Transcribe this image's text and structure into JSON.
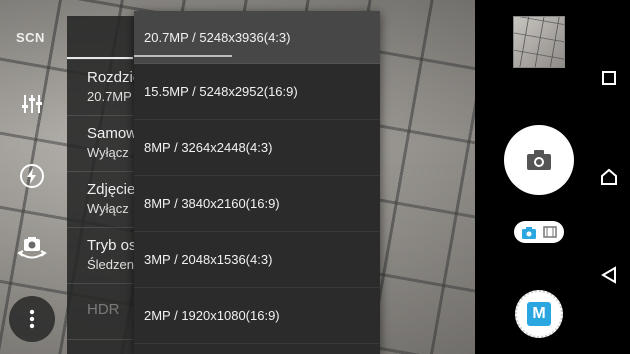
{
  "left_strip": {
    "scene_label": "SCN",
    "icons": [
      "sliders-icon",
      "flash-auto-icon",
      "switch-camera-icon",
      "more-vertical-icon"
    ]
  },
  "settings": {
    "rows": [
      {
        "title": "Rozdzielczość",
        "value": "20.7MP"
      },
      {
        "title": "Samowyzwalacz",
        "value": "Wyłącz"
      },
      {
        "title": "Zdjęcie z uśmiechem",
        "value": "Wyłącz"
      },
      {
        "title": "Tryb ostrości",
        "value": "Śledzenie obiektu"
      },
      {
        "title": "HDR",
        "value": ""
      }
    ]
  },
  "resolution_dropdown": {
    "options": [
      "20.7MP / 5248x3936(4:3)",
      "15.5MP / 5248x2952(16:9)",
      "8MP / 3264x2448(4:3)",
      "8MP / 3840x2160(16:9)",
      "3MP / 2048x1536(4:3)",
      "2MP / 1920x1080(16:9)"
    ],
    "selected_index": 0
  },
  "camera_controls": {
    "manual_label": "M",
    "accent_color": "#2aa6e0"
  },
  "navigation": [
    "recent-apps-icon",
    "home-icon",
    "back-icon"
  ]
}
